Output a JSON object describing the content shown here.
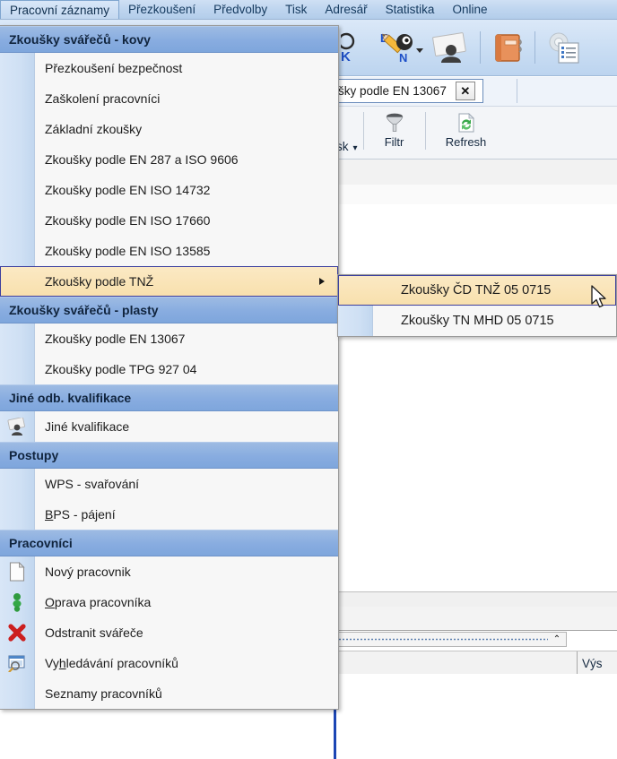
{
  "menubar": {
    "items": [
      {
        "label": "Pracovní záznamy",
        "active": true
      },
      {
        "label": "Přezkoušení",
        "active": false
      },
      {
        "label": "Předvolby",
        "active": false
      },
      {
        "label": "Tisk",
        "active": false
      },
      {
        "label": "Adresář",
        "active": false
      },
      {
        "label": "Statistika",
        "active": false
      },
      {
        "label": "Online",
        "active": false
      }
    ]
  },
  "toolbar": {
    "buttons": [
      {
        "name": "ok-stamp-icon"
      },
      {
        "name": "pencil-en-icon"
      },
      {
        "name": "dropdown-caret"
      },
      {
        "name": "contact-card-icon"
      },
      {
        "name": "address-book-icon"
      },
      {
        "name": "settings-list-icon"
      }
    ]
  },
  "tabstrip": {
    "tab_label": "šky podle EN 13067",
    "close_label": "✕"
  },
  "toolbar2": {
    "print_label": "isk",
    "print_caret": "▾",
    "filter_label": "Filtr",
    "refresh_label": "Refresh"
  },
  "content": {
    "grid_header_col": "Výs",
    "splitter_arrow": "⌃"
  },
  "menu": {
    "groups": [
      {
        "header": "Zkoušky svářečů - kovy",
        "items": [
          {
            "label": "Přezkoušení bezpečnost",
            "icon": null,
            "highlight": false,
            "submenu": false
          },
          {
            "label": "Zaškolení pracovníci",
            "icon": null,
            "highlight": false,
            "submenu": false
          },
          {
            "label": "Základní zkoušky",
            "icon": null,
            "highlight": false,
            "submenu": false
          },
          {
            "label": "Zkoušky podle EN 287 a ISO 9606",
            "icon": null,
            "highlight": false,
            "submenu": false
          },
          {
            "label": "Zkoušky podle EN ISO 14732",
            "icon": null,
            "highlight": false,
            "submenu": false
          },
          {
            "label": "Zkoušky podle EN ISO 17660",
            "icon": null,
            "highlight": false,
            "submenu": false
          },
          {
            "label": "Zkoušky podle EN ISO 13585",
            "icon": null,
            "highlight": false,
            "submenu": false
          },
          {
            "label": "Zkoušky podle TNŽ",
            "icon": null,
            "highlight": true,
            "submenu": true
          }
        ]
      },
      {
        "header": "Zkoušky svářečů - plasty",
        "items": [
          {
            "label": "Zkoušky podle EN 13067",
            "icon": null,
            "highlight": false,
            "submenu": false
          },
          {
            "label": "Zkoušky podle TPG 927 04",
            "icon": null,
            "highlight": false,
            "submenu": false
          }
        ]
      },
      {
        "header": "Jiné odb. kvalifikace",
        "items": [
          {
            "label": "Jiné kvalifikace",
            "icon": "person-card-icon",
            "highlight": false,
            "submenu": false
          }
        ]
      },
      {
        "header": "Postupy",
        "items": [
          {
            "label": "WPS - svařování",
            "icon": null,
            "highlight": false,
            "submenu": false
          },
          {
            "label": "BPS - pájení",
            "icon": null,
            "highlight": false,
            "submenu": false,
            "accel": "B"
          }
        ]
      },
      {
        "header": "Pracovníci",
        "items": [
          {
            "label": "Nový pracovnik",
            "icon": "new-document-icon",
            "highlight": false,
            "submenu": false
          },
          {
            "label": "Oprava pracovníka",
            "icon": "edit-person-icon",
            "highlight": false,
            "submenu": false,
            "accel": "O"
          },
          {
            "label": "Odstranit svářeče",
            "icon": "delete-x-icon",
            "highlight": false,
            "submenu": false
          },
          {
            "label": "Vyhledávání pracovníků",
            "icon": "search-window-icon",
            "highlight": false,
            "submenu": false,
            "accel": "h"
          },
          {
            "label": "Seznamy pracovníků",
            "icon": null,
            "highlight": false,
            "submenu": false
          }
        ]
      }
    ]
  },
  "submenu": {
    "items": [
      {
        "label": "Zkoušky ČD TNŽ 05 0715",
        "highlight": true
      },
      {
        "label": "Zkoušky TN MHD 05 0715",
        "highlight": false
      }
    ]
  },
  "colors": {
    "menubar_bg": "#bed5ef",
    "section_header": "#88ace0",
    "highlight_fill": "#f8e0ad",
    "highlight_border": "#3c3f9e",
    "menu_bg": "#f7f7f7",
    "gutter": "#cfe0f4",
    "pane_border": "#1c46b4"
  }
}
